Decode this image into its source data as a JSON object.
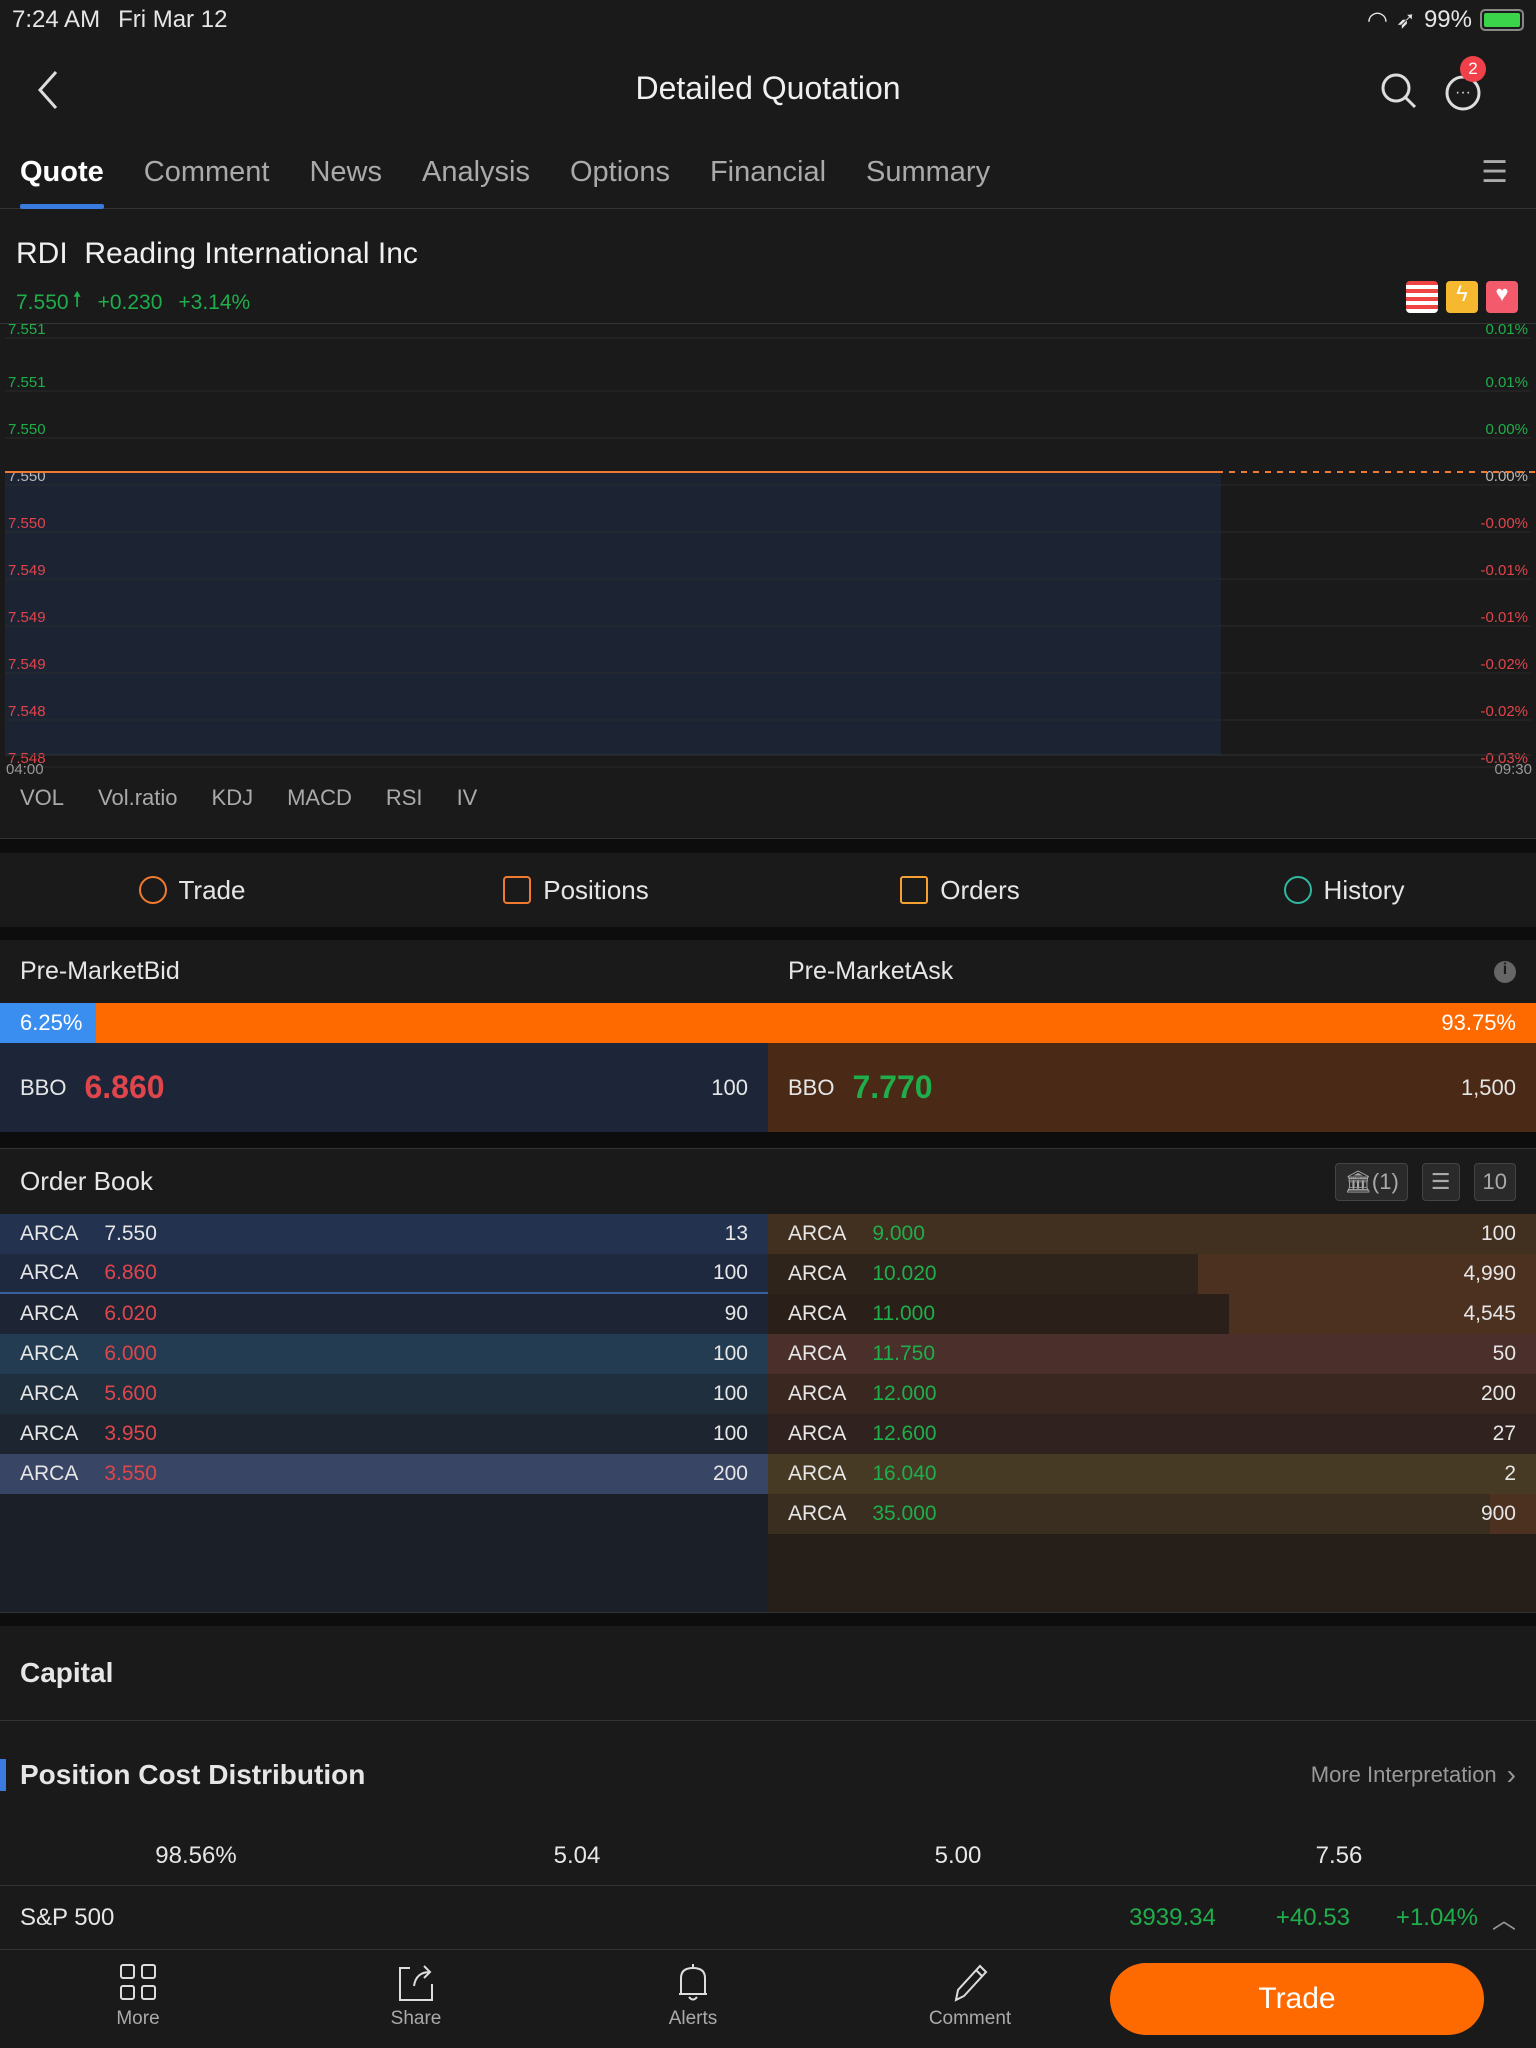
{
  "status_bar": {
    "time": "7:24 AM",
    "date": "Fri Mar 12",
    "battery": "99%"
  },
  "nav": {
    "title": "Detailed Quotation",
    "message_badge": "2"
  },
  "tabs": [
    {
      "label": "Quote",
      "active": true
    },
    {
      "label": "Comment"
    },
    {
      "label": "News"
    },
    {
      "label": "Analysis"
    },
    {
      "label": "Options"
    },
    {
      "label": "Financial"
    },
    {
      "label": "Summary"
    }
  ],
  "stock": {
    "symbol": "RDI",
    "name": "Reading International Inc",
    "price": "7.550",
    "change": "+0.230",
    "change_pct": "+3.14%"
  },
  "chart_data": {
    "type": "line",
    "x_start": "04:00",
    "x_end": "09:30",
    "price": 7.55,
    "progress_fraction": 0.8,
    "left_ticks": [
      "7.551",
      "7.551",
      "7.550",
      "7.550",
      "7.550",
      "7.549",
      "7.549",
      "7.549",
      "7.548",
      "7.548"
    ],
    "right_ticks": [
      "0.01%",
      "0.01%",
      "0.00%",
      "0.00%",
      "-0.00%",
      "-0.01%",
      "-0.01%",
      "-0.02%",
      "-0.02%",
      "-0.03%"
    ],
    "line_color": "#f07a30",
    "fill_color": "#1c2434"
  },
  "indicators": [
    "VOL",
    "Vol.ratio",
    "KDJ",
    "MACD",
    "RSI",
    "IV"
  ],
  "trade_tabs": [
    "Trade",
    "Positions",
    "Orders",
    "History"
  ],
  "premarket": {
    "bid_label": "Pre-MarketBid",
    "ask_label": "Pre-MarketAsk",
    "bid_pct": "6.25%",
    "ask_pct": "93.75%",
    "bid_fraction": 0.0625,
    "bbo_label": "BBO",
    "bid_price": "6.860",
    "bid_size": "100",
    "ask_price": "7.770",
    "ask_size": "1,500"
  },
  "order_book": {
    "title": "Order Book",
    "exchange_count": "(1)",
    "depth": "10",
    "bids": [
      {
        "ex": "ARCA",
        "price": "7.550",
        "size": "13"
      },
      {
        "ex": "ARCA",
        "price": "6.860",
        "size": "100"
      },
      {
        "ex": "ARCA",
        "price": "6.020",
        "size": "90"
      },
      {
        "ex": "ARCA",
        "price": "6.000",
        "size": "100"
      },
      {
        "ex": "ARCA",
        "price": "5.600",
        "size": "100"
      },
      {
        "ex": "ARCA",
        "price": "3.950",
        "size": "100"
      },
      {
        "ex": "ARCA",
        "price": "3.550",
        "size": "200"
      }
    ],
    "asks": [
      {
        "ex": "ARCA",
        "price": "9.000",
        "size": "100"
      },
      {
        "ex": "ARCA",
        "price": "10.020",
        "size": "4,990"
      },
      {
        "ex": "ARCA",
        "price": "11.000",
        "size": "4,545"
      },
      {
        "ex": "ARCA",
        "price": "11.750",
        "size": "50"
      },
      {
        "ex": "ARCA",
        "price": "12.000",
        "size": "200"
      },
      {
        "ex": "ARCA",
        "price": "12.600",
        "size": "27"
      },
      {
        "ex": "ARCA",
        "price": "16.040",
        "size": "2"
      },
      {
        "ex": "ARCA",
        "price": "35.000",
        "size": "900"
      }
    ]
  },
  "capital": {
    "title": "Capital"
  },
  "position_cost": {
    "title": "Position Cost Distribution",
    "more": "More Interpretation",
    "values": [
      "98.56%",
      "5.04",
      "5.00",
      "7.56"
    ]
  },
  "index": {
    "name": "S&P 500",
    "value": "3939.34",
    "change": "+40.53",
    "change_pct": "+1.04%"
  },
  "bottom_bar": {
    "items": [
      "More",
      "Share",
      "Alerts",
      "Comment"
    ],
    "trade": "Trade"
  }
}
